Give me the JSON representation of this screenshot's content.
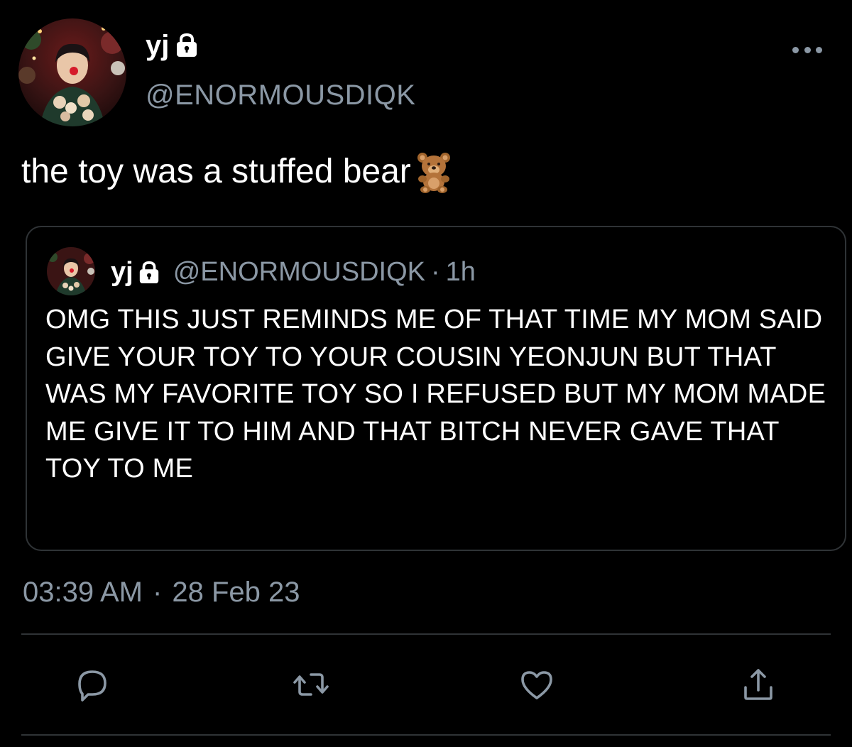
{
  "author": {
    "display_name": "yj",
    "handle": "@ENORMOUSDIQK"
  },
  "tweet": {
    "text": "the toy was a stuffed bear",
    "emoji": "teddy-bear-emoji"
  },
  "quoted_tweet": {
    "display_name": "yj",
    "handle": "@ENORMOUSDIQK",
    "separator": "·",
    "relative_time": "1h",
    "text": "OMG THIS JUST REMINDS ME OF THAT TIME MY MOM SAID GIVE YOUR TOY TO YOUR COUSIN YEONJUN BUT THAT WAS MY FAVORITE TOY SO I REFUSED BUT MY MOM MADE ME GIVE IT TO HIM AND THAT BITCH NEVER GAVE THAT TOY TO ME"
  },
  "meta": {
    "time": "03:39 AM",
    "separator": "·",
    "date": "28 Feb 23"
  },
  "actions": [
    "reply-icon",
    "retweet-icon",
    "like-icon",
    "share-icon"
  ],
  "colors": {
    "background": "#000000",
    "primary_text": "#ffffff",
    "secondary_text": "#8b98a5",
    "border": "#2f3336"
  }
}
